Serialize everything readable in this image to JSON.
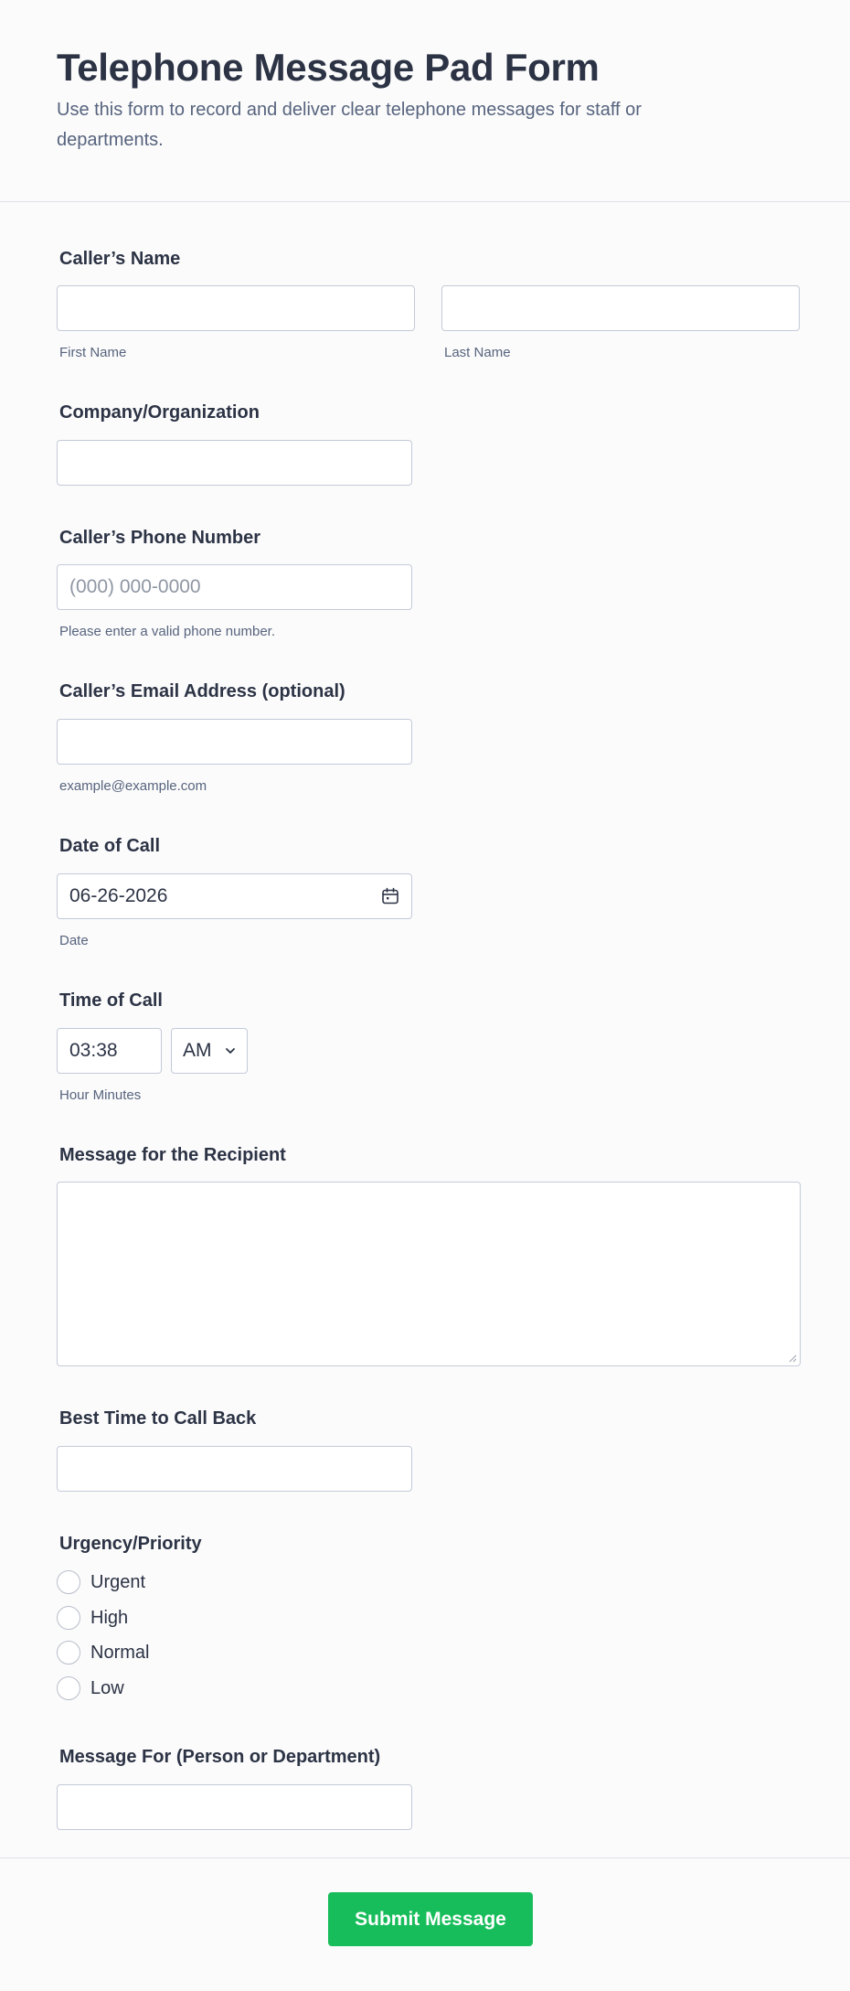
{
  "header": {
    "title": "Telephone Message Pad Form",
    "description": "Use this form to record and deliver clear telephone messages for staff or departments."
  },
  "fields": {
    "callers_name": {
      "label": "Caller’s Name",
      "first_sub": "First Name",
      "last_sub": "Last Name",
      "first_value": "",
      "last_value": ""
    },
    "company": {
      "label": "Company/Organization",
      "value": ""
    },
    "phone": {
      "label": "Caller’s Phone Number",
      "placeholder": "(000) 000-0000",
      "hint": "Please enter a valid phone number."
    },
    "email": {
      "label": "Caller’s Email Address (optional)",
      "value": "",
      "hint": "example@example.com"
    },
    "date": {
      "label": "Date of Call",
      "value": "06-26-2026",
      "sub": "Date"
    },
    "time": {
      "label": "Time of Call",
      "value": "03:38",
      "ampm": "AM",
      "sub": "Hour Minutes"
    },
    "message": {
      "label": "Message for the Recipient",
      "value": ""
    },
    "callback": {
      "label": "Best Time to Call Back",
      "value": ""
    },
    "urgency": {
      "label": "Urgency/Priority",
      "options": [
        "Urgent",
        "High",
        "Normal",
        "Low"
      ]
    },
    "message_for": {
      "label": "Message For (Person or Department)",
      "value": ""
    }
  },
  "submit_label": "Submit Message",
  "icons": {
    "date": "calendar-icon",
    "select": "chevron-down-icon"
  },
  "colors": {
    "accent": "#18bd5b",
    "text": "#2c3345",
    "muted": "#57647e",
    "border": "#c3cad8"
  }
}
